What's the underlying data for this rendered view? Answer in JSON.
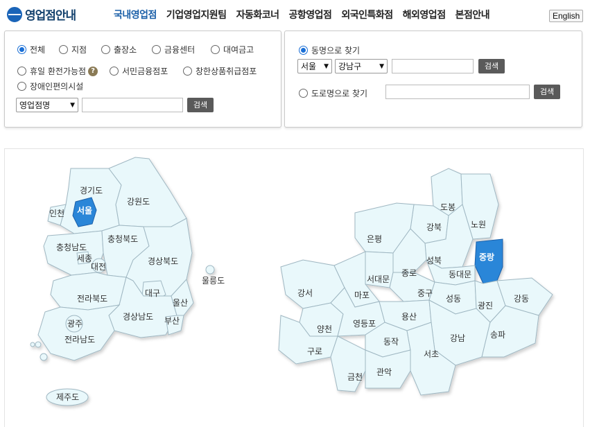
{
  "header": {
    "logo_text": "영업점안내",
    "nav": [
      "국내영업점",
      "기업영업지원팀",
      "자동화코너",
      "공항영업점",
      "외국인특화점",
      "해외영업점",
      "본점안내"
    ],
    "lang_button": "English"
  },
  "left_panel": {
    "radios": [
      "전체",
      "지점",
      "출장소",
      "금융센터",
      "대여금고",
      "휴일 환전가능점",
      "서민금융점포",
      "창한상품취급점포",
      "장애인편의시설"
    ],
    "selected_radio": "전체",
    "select_value": "영업점명",
    "search_label": "검색"
  },
  "right_panel": {
    "option_dong": "동명으로 찾기",
    "option_road": "도로명으로 찾기",
    "selected": "동명으로 찾기",
    "city_value": "서울",
    "district_value": "강남구",
    "search_label": "검색"
  },
  "korea_map": {
    "regions": [
      "경기도",
      "서울",
      "인천",
      "강원도",
      "충청북도",
      "충청남도",
      "세종",
      "대전",
      "경상북도",
      "울릉도",
      "대구",
      "울산",
      "전라북도",
      "경상남도",
      "부산",
      "광주",
      "전라남도",
      "제주도"
    ],
    "active": "서울"
  },
  "seoul_map": {
    "districts": [
      "도봉",
      "노원",
      "강북",
      "은평",
      "성북",
      "중랑",
      "종로",
      "서대문",
      "동대문",
      "강서",
      "마포",
      "중구",
      "성동",
      "광진",
      "강동",
      "양천",
      "영등포",
      "용산",
      "동작",
      "강남",
      "송파",
      "구로",
      "서초",
      "금천",
      "관악"
    ],
    "active": "중랑"
  },
  "colors": {
    "brand": "#1a5fa8",
    "region_fill": "#e9f8fb",
    "active_fill": "#2a86d8"
  }
}
